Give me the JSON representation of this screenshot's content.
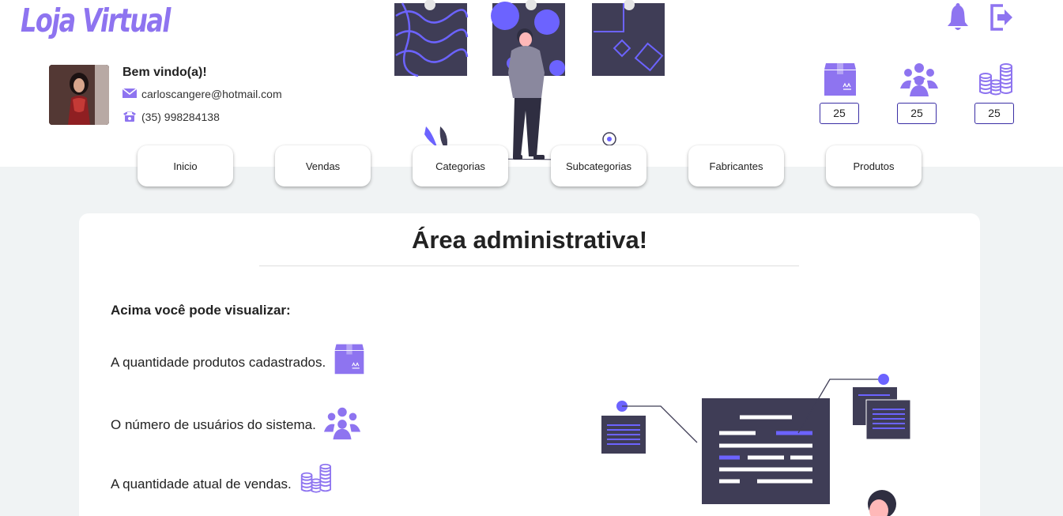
{
  "brand": {
    "logo": "Loja Virtual"
  },
  "user": {
    "welcome": "Bem vindo(a)!",
    "email": "carloscangere@hotmail.com",
    "phone": "(35) 998284138"
  },
  "stats": [
    {
      "icon": "package-icon",
      "value": "25"
    },
    {
      "icon": "users-group-icon",
      "value": "25"
    },
    {
      "icon": "coins-icon",
      "value": "25"
    }
  ],
  "nav": [
    {
      "label": "Inicio"
    },
    {
      "label": "Vendas"
    },
    {
      "label": "Categorias"
    },
    {
      "label": "Subcategorias"
    },
    {
      "label": "Fabricantes"
    },
    {
      "label": "Produtos"
    }
  ],
  "main": {
    "title": "Área administrativa!",
    "subtitle": "Acima você pode visualizar:",
    "lines": [
      {
        "text": "A quantidade produtos cadastrados.",
        "icon": "package-icon"
      },
      {
        "text": "O número de usuários do sistema.",
        "icon": "users-group-icon"
      },
      {
        "text": "A quantidade atual de vendas.",
        "icon": "coins-icon"
      }
    ]
  },
  "colors": {
    "accent": "#8e74f0",
    "dark": "#3f3d56",
    "bg": "#f0f3f4"
  }
}
